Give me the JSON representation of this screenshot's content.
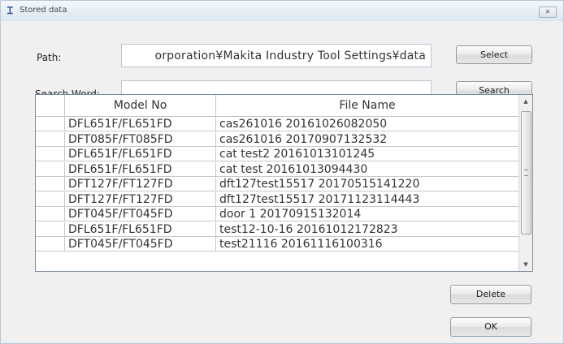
{
  "window": {
    "title": "Stored data",
    "close_glyph": "✕"
  },
  "path": {
    "label": "Path:",
    "value": "orporation¥Makita Industry Tool Settings¥data",
    "button": "Select"
  },
  "search": {
    "label": "Search Word:",
    "value": "",
    "placeholder": "",
    "button": "Search"
  },
  "table": {
    "columns": [
      "Model No",
      "File Name"
    ],
    "rows": [
      [
        "DFL651F/FL651FD",
        "cas261016 20161026082050"
      ],
      [
        "DFT085F/FT085FD",
        "cas261016 20170907132532"
      ],
      [
        "DFL651F/FL651FD",
        "cat test2 20161013101245"
      ],
      [
        "DFL651F/FL651FD",
        "cat test 20161013094430"
      ],
      [
        "DFT127F/FT127FD",
        "dft127test15517 20170515141220"
      ],
      [
        "DFT127F/FT127FD",
        "dft127test15517 20171123114443"
      ],
      [
        "DFT045F/FT045FD",
        "door 1 20170915132014"
      ],
      [
        "DFL651F/FL651FD",
        "test12-10-16 20161012172823"
      ],
      [
        "DFT045F/FT045FD",
        "test21116 20161116100316"
      ]
    ]
  },
  "actions": {
    "delete": "Delete",
    "ok": "OK"
  },
  "icons": {
    "app": "app-icon",
    "scroll_up": "▲",
    "scroll_down": "▼"
  }
}
